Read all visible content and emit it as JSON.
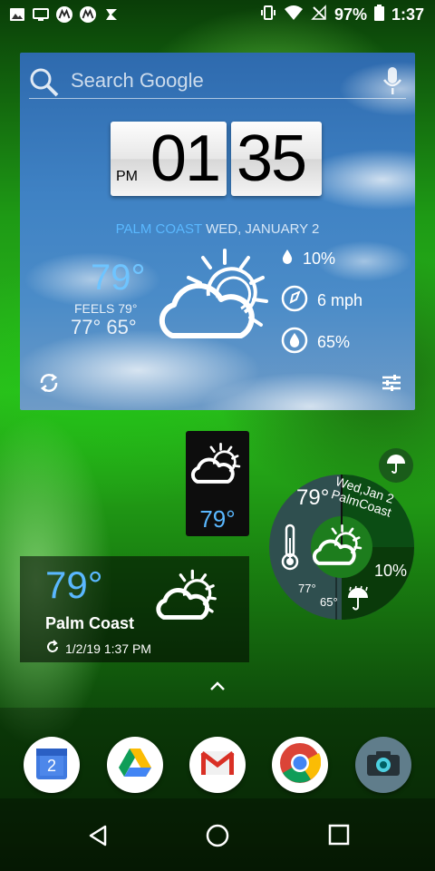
{
  "status_bar": {
    "battery": "97%",
    "time": "1:37",
    "left_icons": [
      "image-icon",
      "screen-cast-icon",
      "motorola-icon",
      "motorola-icon",
      "voice-icon"
    ],
    "right_icons": [
      "vibrate-icon",
      "wifi-icon",
      "no-signal-icon",
      "battery-icon"
    ]
  },
  "weather_main": {
    "search_placeholder": "Search Google",
    "clock_period": "PM",
    "clock_hour": "01",
    "clock_minute": "35",
    "city": "PALM COAST",
    "date": "WED, JANUARY 2",
    "temperature": "79°",
    "feels_like": "FEELS 79°",
    "hi_lo": "77° 65°",
    "precip": "10%",
    "wind": "6 mph",
    "humidity": "65%",
    "condition_icon": "partly-cloudy-icon"
  },
  "weather_small": {
    "temperature": "79°",
    "condition_icon": "partly-cloudy-icon"
  },
  "weather_wide": {
    "temperature": "79°",
    "city": "Palm Coast",
    "updated": "1/2/19 1:37 PM",
    "condition_icon": "partly-cloudy-icon"
  },
  "weather_round": {
    "temperature": "79°",
    "date_line1": "Wed,Jan 2",
    "date_line2": "PalmCoast",
    "high": "77°",
    "low": "65°",
    "precip": "10%"
  },
  "dock": {
    "apps": [
      {
        "name": "Calendar",
        "badge": "2"
      },
      {
        "name": "Drive"
      },
      {
        "name": "Gmail"
      },
      {
        "name": "Chrome"
      },
      {
        "name": "Camera"
      }
    ]
  },
  "colors": {
    "accent_blue": "#5ab8ff",
    "wallpaper_green": "#2bbf1c"
  }
}
